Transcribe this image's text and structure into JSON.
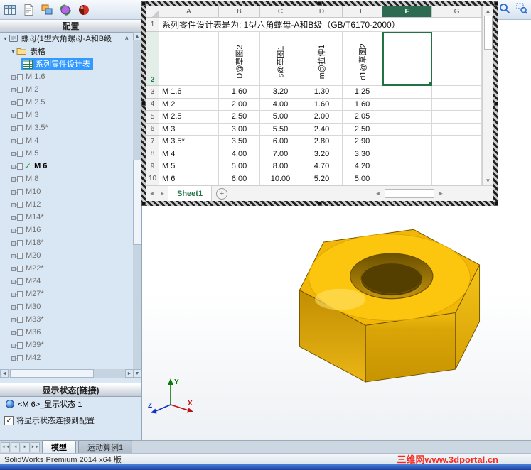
{
  "toolbar": {
    "icons": [
      "table-icon",
      "sheet-icon",
      "windows-icon",
      "motion-icon",
      "material-icon"
    ],
    "viewport_tools": [
      "zoom-icon",
      "zoom-area-icon"
    ]
  },
  "config_panel": {
    "header": "配置",
    "root_label": "螺母(1型六角螺母-A和B级",
    "tables_folder": "表格",
    "design_table": "系列零件设计表",
    "configurations": [
      {
        "name": "M 1.6"
      },
      {
        "name": "M 2"
      },
      {
        "name": "M 2.5"
      },
      {
        "name": "M 3"
      },
      {
        "name": "M 3.5*"
      },
      {
        "name": "M 4"
      },
      {
        "name": "M 5"
      },
      {
        "name": "M 6",
        "active": true
      },
      {
        "name": "M 8"
      },
      {
        "name": "M10"
      },
      {
        "name": "M12"
      },
      {
        "name": "M14*"
      },
      {
        "name": "M16"
      },
      {
        "name": "M18*"
      },
      {
        "name": "M20"
      },
      {
        "name": "M22*"
      },
      {
        "name": "M24"
      },
      {
        "name": "M27*"
      },
      {
        "name": "M30"
      },
      {
        "name": "M33*"
      },
      {
        "name": "M36"
      },
      {
        "name": "M39*"
      },
      {
        "name": "M42"
      }
    ]
  },
  "display_states": {
    "header": "显示状态(链接)",
    "item": "<M 6>_显示状态 1",
    "link_checkbox": "将显示状态连接到配置",
    "checked": true
  },
  "excel": {
    "title": "系列零件设计表是为: 1型六角螺母-A和B级（GB/T6170-2000）",
    "columns": [
      "A",
      "B",
      "C",
      "D",
      "E",
      "F",
      "G"
    ],
    "active_column": "F",
    "row_numbers": [
      "1",
      "2",
      "3",
      "4",
      "5",
      "6",
      "7",
      "8",
      "9",
      "10"
    ],
    "active_row": "2",
    "active_cell": "F2",
    "param_headers": [
      "D@草图2",
      "s@草图1",
      "m@拉伸1",
      "d1@草图2"
    ],
    "rows": [
      {
        "config": "M 1.6",
        "values": [
          "1.60",
          "3.20",
          "1.30",
          "1.25"
        ]
      },
      {
        "config": "M 2",
        "values": [
          "2.00",
          "4.00",
          "1.60",
          "1.60"
        ]
      },
      {
        "config": "M 2.5",
        "values": [
          "2.50",
          "5.00",
          "2.00",
          "2.05"
        ]
      },
      {
        "config": "M 3",
        "values": [
          "3.00",
          "5.50",
          "2.40",
          "2.50"
        ]
      },
      {
        "config": "M 3.5*",
        "values": [
          "3.50",
          "6.00",
          "2.80",
          "2.90"
        ]
      },
      {
        "config": "M 4",
        "values": [
          "4.00",
          "7.00",
          "3.20",
          "3.30"
        ]
      },
      {
        "config": "M 5",
        "values": [
          "5.00",
          "8.00",
          "4.70",
          "4.20"
        ]
      },
      {
        "config": "M 6",
        "values": [
          "6.00",
          "10.00",
          "5.20",
          "5.00"
        ]
      }
    ],
    "sheet_tab": "Sheet1"
  },
  "bottom_tabs": {
    "model": "模型",
    "motion_study": "运动算例1"
  },
  "status_bar": {
    "app": "SolidWorks Premium 2014 x64 版",
    "watermark": "三维网www.3dportal.cn"
  },
  "triad": {
    "x": "X",
    "y": "Y",
    "z": "Z"
  },
  "colors": {
    "selection_blue": "#3399ff",
    "excel_green": "#217346",
    "nut_gold": "#f1b606",
    "watermark_red": "#f42a1e"
  }
}
